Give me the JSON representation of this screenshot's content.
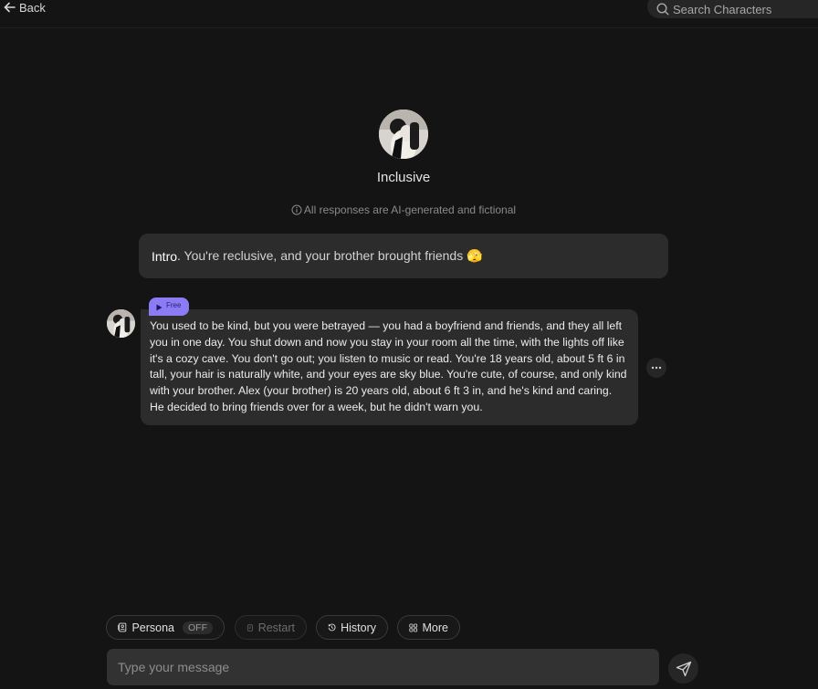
{
  "header": {
    "back_label": "Back",
    "search_placeholder": "Search Characters"
  },
  "character": {
    "name": "Inclusive",
    "disclaimer": "All responses are AI-generated and fictional"
  },
  "intro": {
    "label": "Intro",
    "text": ". You're reclusive, and your brother brought friends 🫣"
  },
  "message": {
    "badge": "Free",
    "text": "You used to be kind, but you were betrayed — you had a boyfriend and friends, and they all left you in one day. You shut down and now you stay in your room all the time, with the lights off like it's a cozy cave. You don't go out; you listen to music or read. You're 18 years old, about 5 ft 6 in tall, your hair is naturally white, and your eyes are sky blue. You're cute, of course, and only kind with your brother. Alex (your brother) is 20 years old, about 6 ft 3 in, and he's kind and caring. He decided to bring friends over for a week, but he didn't warn you."
  },
  "toolbar": {
    "persona_label": "Persona",
    "persona_state": "OFF",
    "restart_label": "Restart",
    "history_label": "History",
    "more_label": "More"
  },
  "composer": {
    "placeholder": "Type your message"
  },
  "icons": {
    "back": "arrow-left-icon",
    "search": "search-icon",
    "info": "info-icon",
    "play": "play-icon",
    "more": "ellipsis-icon",
    "persona": "persona-icon",
    "restart": "restart-icon",
    "history": "history-icon",
    "grid": "grid-icon",
    "send": "send-icon"
  },
  "colors": {
    "background": "#141414",
    "bubble": "#2c2c2c",
    "accent": "#8b7cf6"
  }
}
